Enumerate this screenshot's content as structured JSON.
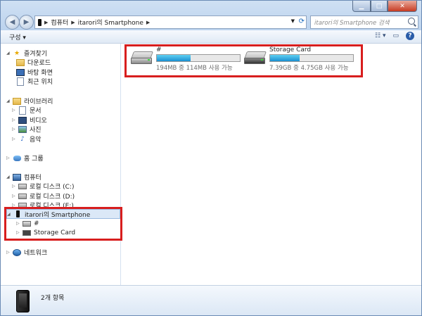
{
  "window": {
    "controls": {
      "minimize": "▁",
      "maximize": "□",
      "close": "✕"
    }
  },
  "address": {
    "segments": [
      "컴퓨터",
      "itarori의 Smartphone"
    ]
  },
  "search": {
    "placeholder": "itarori의 Smartphone 검색"
  },
  "toolbar": {
    "organize": "구성 ▾"
  },
  "nav": {
    "favorites": {
      "label": "즐겨찾기",
      "items": [
        "다운로드",
        "바탕 화면",
        "최근 위치"
      ]
    },
    "libraries": {
      "label": "라이브러리",
      "items": [
        "문서",
        "비디오",
        "사진",
        "음악"
      ]
    },
    "homegroup": {
      "label": "홈 그룹"
    },
    "computer": {
      "label": "컴퓨터",
      "items": [
        "로컬 디스크 (C:)",
        "로컬 디스크 (D:)",
        "로컬 디스크 (E:)"
      ]
    },
    "smartphone": {
      "label": "itarori의 Smartphone",
      "items": [
        "#",
        "Storage Card"
      ]
    },
    "network": {
      "label": "네트워크"
    }
  },
  "drives": [
    {
      "name": "#",
      "size": "194MB 중 114MB 사용 가능",
      "used_fraction": 0.41
    },
    {
      "name": "Storage Card",
      "size": "7.39GB 중 4.75GB 사용 가능",
      "used_fraction": 0.36
    }
  ],
  "details": {
    "count": "2개 항목"
  },
  "colors": {
    "highlight": "#d81e1e",
    "selection": "#dbe8f7"
  }
}
